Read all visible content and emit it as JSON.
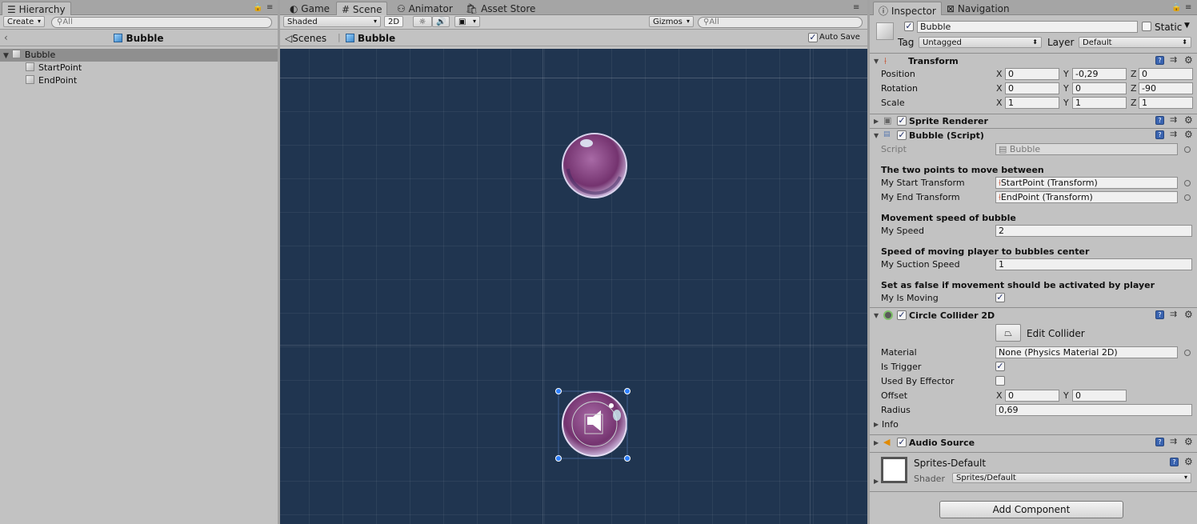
{
  "hierarchy": {
    "tab": "Hierarchy",
    "create": "Create",
    "search_placeholder": "All",
    "scene_name": "Bubble",
    "items": [
      {
        "label": "Bubble"
      },
      {
        "label": "StartPoint"
      },
      {
        "label": "EndPoint"
      }
    ]
  },
  "scene": {
    "tabs": [
      "Game",
      "Scene",
      "Animator",
      "Asset Store"
    ],
    "shading": "Shaded",
    "mode_2d": "2D",
    "gizmos": "Gizmos",
    "search_placeholder": "All",
    "breadcrumb_root": "Scenes",
    "breadcrumb_item": "Bubble",
    "auto_save": "Auto Save"
  },
  "inspector": {
    "tabs": [
      "Inspector",
      "Navigation"
    ],
    "object_name": "Bubble",
    "static_label": "Static",
    "tag_label": "Tag",
    "tag_value": "Untagged",
    "layer_label": "Layer",
    "layer_value": "Default",
    "transform": {
      "title": "Transform",
      "position_label": "Position",
      "rotation_label": "Rotation",
      "scale_label": "Scale",
      "position": {
        "x": "0",
        "y": "-0,29",
        "z": "0"
      },
      "rotation": {
        "x": "0",
        "y": "0",
        "z": "-90"
      },
      "scale": {
        "x": "1",
        "y": "1",
        "z": "1"
      }
    },
    "sprite_renderer": {
      "title": "Sprite Renderer"
    },
    "bubble_script": {
      "title": "Bubble (Script)",
      "script_label": "Script",
      "script_value": "Bubble",
      "header1": "The two points to move between",
      "start_label": "My Start Transform",
      "start_value": "StartPoint (Transform)",
      "end_label": "My End Transform",
      "end_value": "EndPoint (Transform)",
      "header2": "Movement speed of bubble",
      "speed_label": "My Speed",
      "speed_value": "2",
      "header3": "Speed of moving player to bubbles center",
      "suction_label": "My Suction Speed",
      "suction_value": "1",
      "header4": "Set as false if movement should be activated by player",
      "moving_label": "My Is Moving"
    },
    "circle_collider": {
      "title": "Circle Collider 2D",
      "edit_collider": "Edit Collider",
      "material_label": "Material",
      "material_value": "None (Physics Material 2D)",
      "trigger_label": "Is Trigger",
      "effector_label": "Used By Effector",
      "offset_label": "Offset",
      "offset": {
        "x": "0",
        "y": "0"
      },
      "radius_label": "Radius",
      "radius_value": "0,69",
      "info_label": "Info"
    },
    "audio_source": {
      "title": "Audio Source"
    },
    "material": {
      "name": "Sprites-Default",
      "shader_label": "Shader",
      "shader_value": "Sprites/Default"
    },
    "add_component": "Add Component",
    "axes": {
      "x": "X",
      "y": "Y",
      "z": "Z"
    }
  }
}
